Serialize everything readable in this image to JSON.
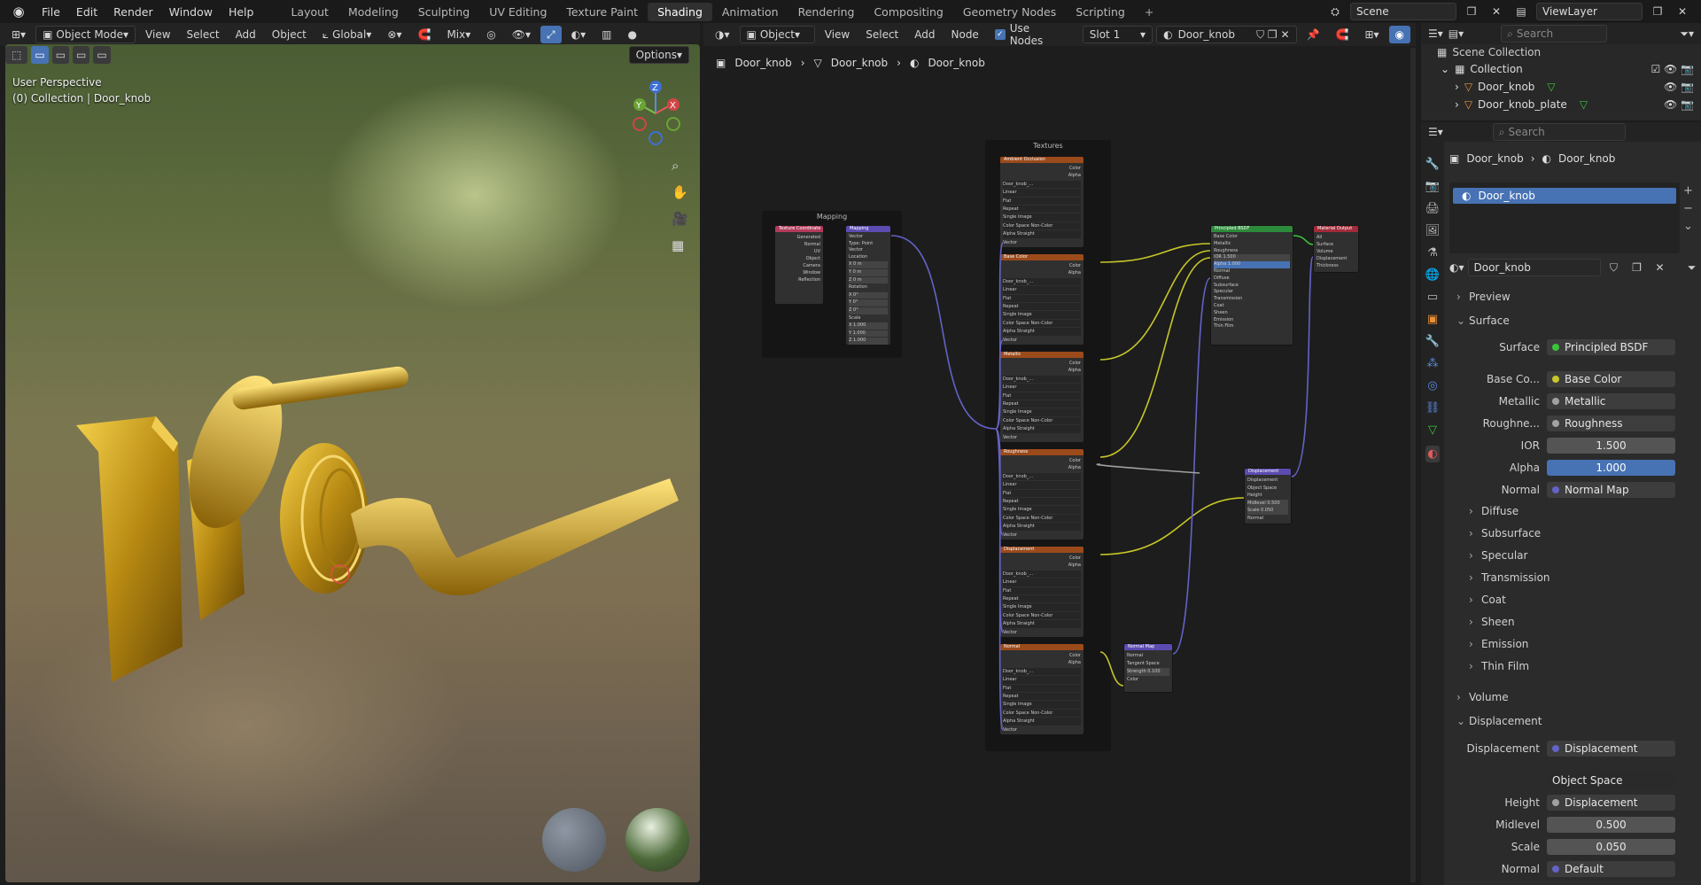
{
  "topbar": {
    "menus": [
      "File",
      "Edit",
      "Render",
      "Window",
      "Help"
    ],
    "workspaces": [
      "Layout",
      "Modeling",
      "Sculpting",
      "UV Editing",
      "Texture Paint",
      "Shading",
      "Animation",
      "Rendering",
      "Compositing",
      "Geometry Nodes",
      "Scripting"
    ],
    "active_workspace": "Shading",
    "scene": "Scene",
    "view_layer": "ViewLayer"
  },
  "viewport_header": {
    "mode": "Object Mode",
    "menus": [
      "View",
      "Select",
      "Add",
      "Object"
    ],
    "transform": "Global",
    "blend": "Mix",
    "options": "Options"
  },
  "viewport": {
    "perspective": "User Perspective",
    "collection": "(0) Collection | Door_knob",
    "gizmo": {
      "z": "Z",
      "y": "Y",
      "x": "X"
    }
  },
  "node_header": {
    "type": "Object",
    "menus": [
      "View",
      "Select",
      "Add",
      "Node"
    ],
    "use_nodes": "Use Nodes",
    "slot": "Slot 1",
    "material": "Door_knob"
  },
  "breadcrumb": [
    "Door_knob",
    "Door_knob",
    "Door_knob"
  ],
  "nodes": {
    "mapping_frame": "Mapping",
    "textures_frame": "Textures",
    "texcoord": "Texture Coordinate",
    "mapping": "Mapping",
    "bsdf": "Principled BSDF",
    "output": "Material Output",
    "displacement": "Displacement",
    "normalmap": "Normal Map",
    "tex_nodes": [
      "Ambient Occlusion",
      "Base Color",
      "Metallic",
      "Roughness",
      "Displacement",
      "Normal"
    ],
    "texcoord_outputs": [
      "Generated",
      "Normal",
      "UV",
      "Object",
      "Camera",
      "Window",
      "Reflection"
    ],
    "mapping_rows": [
      "Vector",
      "Type: Point",
      "Vector",
      "Location",
      "X 0 m",
      "Y 0 m",
      "Z 0 m",
      "Rotation",
      "X 0°",
      "Y 0°",
      "Z 0°",
      "Scale",
      "X 1.000",
      "Y 1.000",
      "Z 1.000"
    ],
    "bsdf_inputs": [
      "Base Color",
      "Metallic",
      "Roughness",
      "IOR 1.500",
      "Alpha 1.000",
      "Normal",
      "Diffuse",
      "Subsurface",
      "Specular",
      "Transmission",
      "Coat",
      "Sheen",
      "Emission",
      "Thin Film"
    ],
    "output_inputs": [
      "All",
      "Surface",
      "Volume",
      "Displacement",
      "Thickness"
    ],
    "disp_rows": [
      "Displacement",
      "Object Space",
      "Height",
      "Midlevel 0.500",
      "Scale 0.050",
      "Normal"
    ],
    "normal_rows": [
      "Normal",
      "Tangent Space",
      "Strength 0.100",
      "Color"
    ],
    "tex_rows": [
      "Color",
      "Alpha",
      "Door_knob_...",
      "Linear",
      "Flat",
      "Repeat",
      "Single Image",
      "Color Space  Non-Color",
      "Alpha  Straight",
      "Vector"
    ]
  },
  "outliner": {
    "search": "Search",
    "root": "Scene Collection",
    "collection": "Collection",
    "items": [
      "Door_knob",
      "Door_knob_plate"
    ]
  },
  "properties": {
    "search": "Search",
    "breadcrumb": [
      "Door_knob",
      "Door_knob"
    ],
    "slot_item": "Door_knob",
    "material_name": "Door_knob",
    "sections": {
      "preview": "Preview",
      "surface": "Surface",
      "volume": "Volume",
      "displacement": "Displacement"
    },
    "rows": [
      {
        "label": "Surface",
        "value": "Principled BSDF",
        "dot": "#3ac43a"
      },
      {
        "label": "Base Co...",
        "value": "Base Color",
        "dot": "#c7c729"
      },
      {
        "label": "Metallic",
        "value": "Metallic",
        "dot": "#a1a1a1"
      },
      {
        "label": "Roughne...",
        "value": "Roughness",
        "dot": "#a1a1a1"
      },
      {
        "label": "IOR",
        "value": "1.500"
      },
      {
        "label": "Alpha",
        "value": "1.000"
      },
      {
        "label": "Normal",
        "value": "Normal Map",
        "dot": "#6363c7"
      }
    ],
    "subsections": [
      "Diffuse",
      "Subsurface",
      "Specular",
      "Transmission",
      "Coat",
      "Sheen",
      "Emission",
      "Thin Film"
    ],
    "disp_rows": [
      {
        "label": "Displacement",
        "value": "Displacement",
        "dot": "#6363c7"
      },
      {
        "label": "",
        "value": "Object Space"
      },
      {
        "label": "Height",
        "value": "Displacement",
        "dot": "#a1a1a1"
      },
      {
        "label": "Midlevel",
        "value": "0.500"
      },
      {
        "label": "Scale",
        "value": "0.050"
      },
      {
        "label": "Normal",
        "value": "Default",
        "dot": "#6363c7"
      }
    ]
  }
}
